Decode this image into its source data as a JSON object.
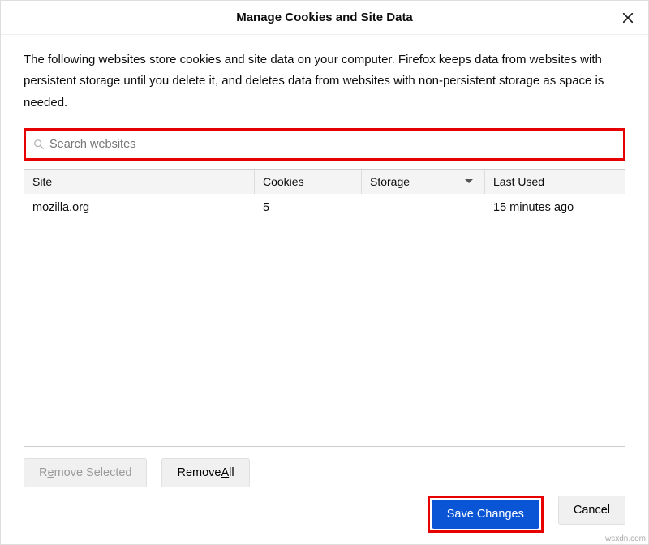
{
  "dialog": {
    "title": "Manage Cookies and Site Data",
    "description": "The following websites store cookies and site data on your computer. Firefox keeps data from websites with persistent storage until you delete it, and deletes data from websites with non-persistent storage as space is needed."
  },
  "search": {
    "placeholder": "Search websites",
    "value": ""
  },
  "table": {
    "headers": {
      "site": "Site",
      "cookies": "Cookies",
      "storage": "Storage",
      "lastused": "Last Used"
    },
    "sorted_column": "storage",
    "rows": [
      {
        "site": "mozilla.org",
        "cookies": "5",
        "storage": "",
        "lastused": "15 minutes ago"
      }
    ]
  },
  "buttons": {
    "remove_selected_pre": "R",
    "remove_selected_hot": "e",
    "remove_selected_post": "move Selected",
    "remove_all_pre": "Remove ",
    "remove_all_hot": "A",
    "remove_all_post": "ll",
    "save_changes": "Save Changes",
    "cancel": "Cancel"
  },
  "watermark": "wsxdn.com"
}
